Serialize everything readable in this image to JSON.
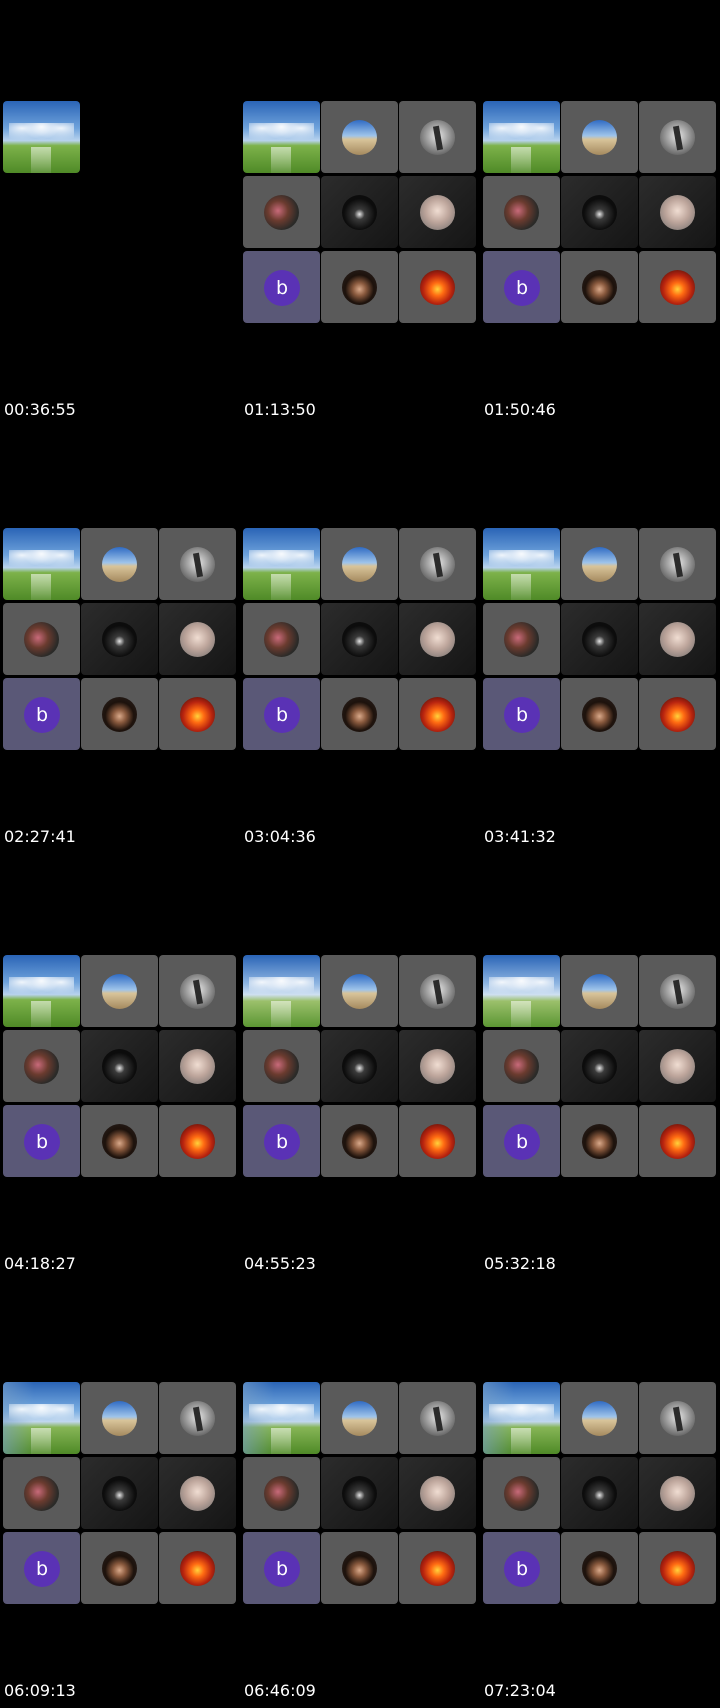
{
  "frames": [
    {
      "timestamp": "00:36:55",
      "variant": "single"
    },
    {
      "timestamp": "01:13:50",
      "variant": "full"
    },
    {
      "timestamp": "01:50:46",
      "variant": "full"
    },
    {
      "timestamp": "02:27:41",
      "variant": "full"
    },
    {
      "timestamp": "03:04:36",
      "variant": "full"
    },
    {
      "timestamp": "03:41:32",
      "variant": "full"
    },
    {
      "timestamp": "04:18:27",
      "variant": "full"
    },
    {
      "timestamp": "04:55:23",
      "variant": "full"
    },
    {
      "timestamp": "05:32:18",
      "variant": "full"
    },
    {
      "timestamp": "06:09:13",
      "variant": "full"
    },
    {
      "timestamp": "06:46:09",
      "variant": "full"
    },
    {
      "timestamp": "07:23:04",
      "variant": "full"
    }
  ],
  "grid": {
    "tiles": [
      {
        "name": "stadium-tile",
        "icon": "stadium-image"
      },
      {
        "name": "beach-avatar-tile",
        "icon": "beach-avatar"
      },
      {
        "name": "tree-avatar-tile",
        "icon": "tree-avatar"
      },
      {
        "name": "couple-avatar-tile",
        "icon": "couple-avatar"
      },
      {
        "name": "person-avatar-tile",
        "icon": "person-avatar"
      },
      {
        "name": "elderly-avatar-tile",
        "icon": "elderly-avatar"
      },
      {
        "name": "letter-avatar-tile",
        "icon": "letter-avatar",
        "letter": "b"
      },
      {
        "name": "curly-hair-avatar-tile",
        "icon": "curly-hair-avatar"
      },
      {
        "name": "fire-avatar-tile",
        "icon": "fire-avatar"
      }
    ]
  },
  "colors": {
    "background": "#000000",
    "tile": "#5a5a5a",
    "letter_tile": "#5a5877",
    "letter_avatar": "#5a32b5",
    "timestamp_text": "#ffffff"
  }
}
